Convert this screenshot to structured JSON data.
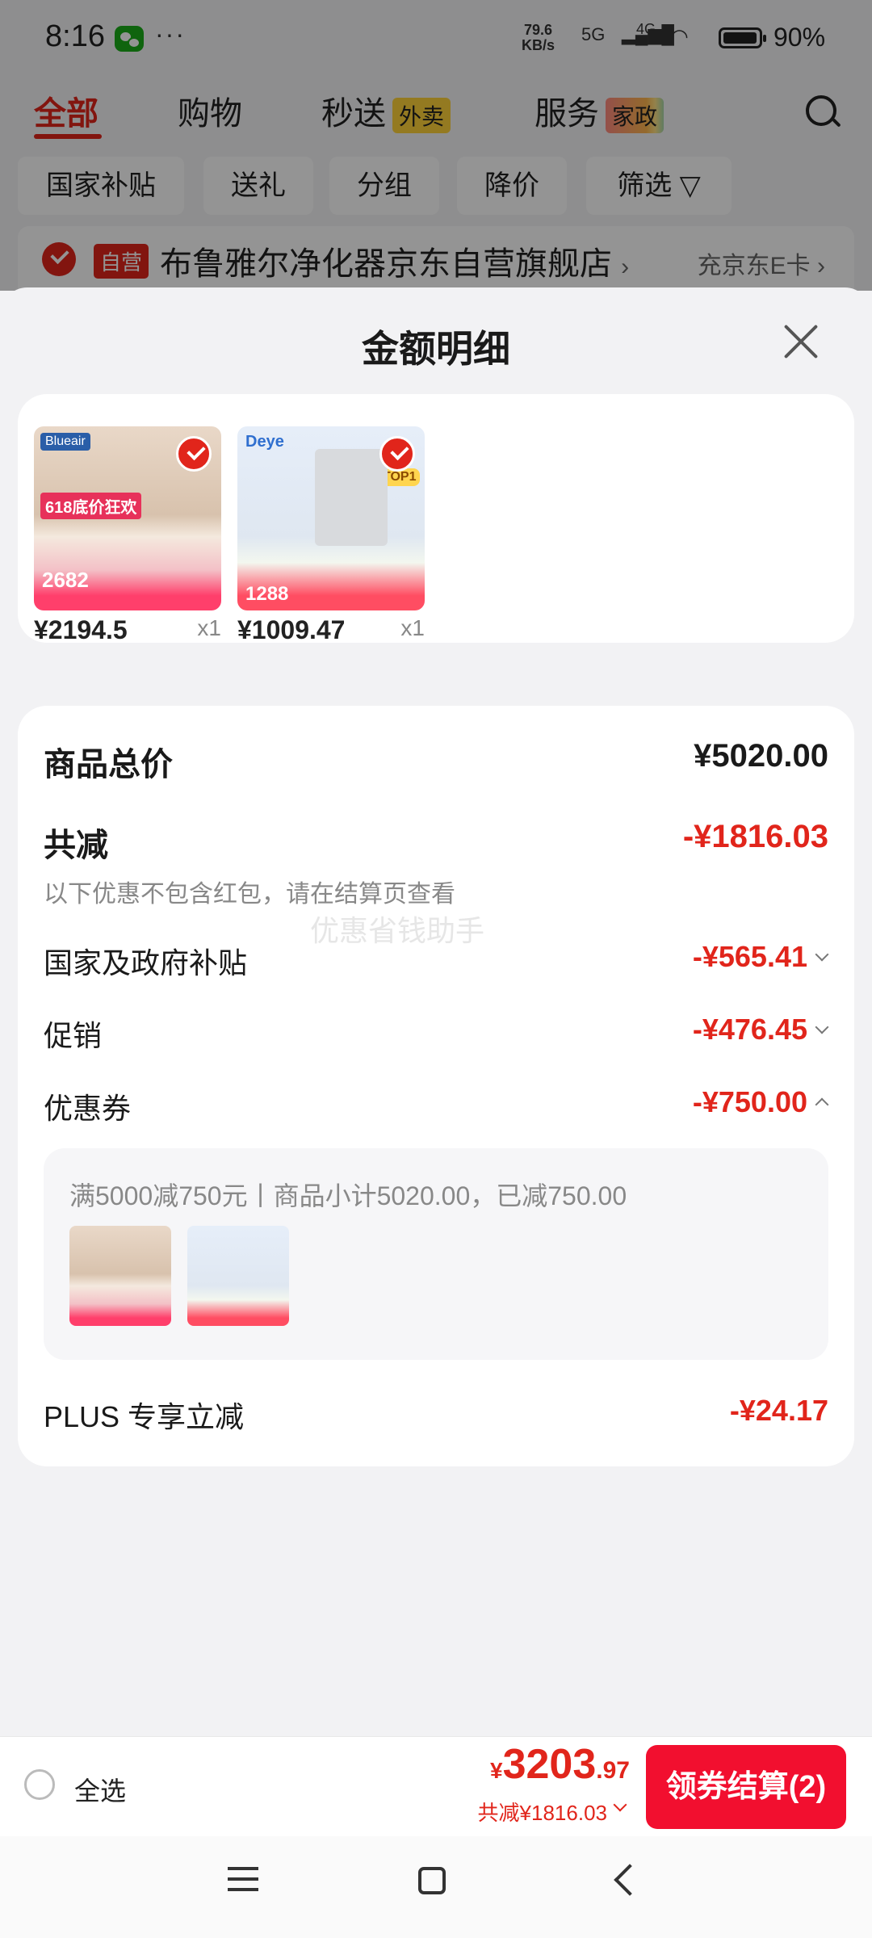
{
  "status_bar": {
    "time": "8:16",
    "more": "···",
    "net_speed_value": "79.6",
    "net_speed_unit": "KB/s",
    "sig1": "5G",
    "sig2": "4G",
    "battery": "90%"
  },
  "tabs": [
    {
      "label": "全部"
    },
    {
      "label": "购物"
    },
    {
      "label": "秒送",
      "badge": "外卖"
    },
    {
      "label": "服务",
      "badge": "家政"
    }
  ],
  "filters": [
    "国家补贴",
    "送礼",
    "分组",
    "降价",
    "筛选"
  ],
  "store": {
    "badge": "自营",
    "name": "布鲁雅尔净化器京东自营旗舰店",
    "arrow": "›",
    "link": "充京东E卡 ›"
  },
  "sheet": {
    "title": "金额明细",
    "products": [
      {
        "price": "¥2194.5",
        "qty": "x1",
        "brand": "Blueair",
        "tag": "618底价狂欢",
        "img_price": "2682"
      },
      {
        "price": "¥1009.47",
        "qty": "x1",
        "brand": "Deye",
        "tag": "TOP1",
        "img_price": "1288"
      }
    ],
    "detail": {
      "total_label": "商品总价",
      "total_value": "¥5020.00",
      "reduce_label": "共减",
      "reduce_value": "-¥1816.03",
      "note": "以下优惠不包含红包，请在结算页查看",
      "watermark": "优惠省钱助手",
      "subsidy_label": "国家及政府补贴",
      "subsidy_value": "-¥565.41",
      "promo_label": "促销",
      "promo_value": "-¥476.45",
      "coupon_label": "优惠券",
      "coupon_value": "-¥750.00",
      "coupon_desc": "满5000减750元丨商品小计5020.00，已减750.00",
      "plus_label": "PLUS 专享立减",
      "plus_value": "-¥24.17"
    }
  },
  "bottom": {
    "select_all": "全选",
    "currency": "¥",
    "total_int": "3203",
    "total_dec": ".97",
    "saved": "共减¥1816.03",
    "checkout": "领券结算(2)"
  },
  "colors": {
    "accent": "#e1251b",
    "checkout": "#f20f2f"
  }
}
